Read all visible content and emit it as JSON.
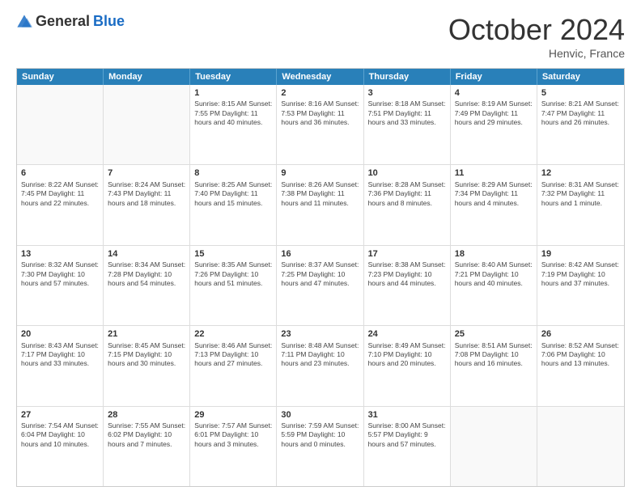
{
  "header": {
    "logo_general": "General",
    "logo_blue": "Blue",
    "month_title": "October 2024",
    "location": "Henvic, France"
  },
  "days_of_week": [
    "Sunday",
    "Monday",
    "Tuesday",
    "Wednesday",
    "Thursday",
    "Friday",
    "Saturday"
  ],
  "rows": [
    [
      {
        "day": "",
        "info": ""
      },
      {
        "day": "",
        "info": ""
      },
      {
        "day": "1",
        "info": "Sunrise: 8:15 AM\nSunset: 7:55 PM\nDaylight: 11 hours and 40 minutes."
      },
      {
        "day": "2",
        "info": "Sunrise: 8:16 AM\nSunset: 7:53 PM\nDaylight: 11 hours and 36 minutes."
      },
      {
        "day": "3",
        "info": "Sunrise: 8:18 AM\nSunset: 7:51 PM\nDaylight: 11 hours and 33 minutes."
      },
      {
        "day": "4",
        "info": "Sunrise: 8:19 AM\nSunset: 7:49 PM\nDaylight: 11 hours and 29 minutes."
      },
      {
        "day": "5",
        "info": "Sunrise: 8:21 AM\nSunset: 7:47 PM\nDaylight: 11 hours and 26 minutes."
      }
    ],
    [
      {
        "day": "6",
        "info": "Sunrise: 8:22 AM\nSunset: 7:45 PM\nDaylight: 11 hours and 22 minutes."
      },
      {
        "day": "7",
        "info": "Sunrise: 8:24 AM\nSunset: 7:43 PM\nDaylight: 11 hours and 18 minutes."
      },
      {
        "day": "8",
        "info": "Sunrise: 8:25 AM\nSunset: 7:40 PM\nDaylight: 11 hours and 15 minutes."
      },
      {
        "day": "9",
        "info": "Sunrise: 8:26 AM\nSunset: 7:38 PM\nDaylight: 11 hours and 11 minutes."
      },
      {
        "day": "10",
        "info": "Sunrise: 8:28 AM\nSunset: 7:36 PM\nDaylight: 11 hours and 8 minutes."
      },
      {
        "day": "11",
        "info": "Sunrise: 8:29 AM\nSunset: 7:34 PM\nDaylight: 11 hours and 4 minutes."
      },
      {
        "day": "12",
        "info": "Sunrise: 8:31 AM\nSunset: 7:32 PM\nDaylight: 11 hours and 1 minute."
      }
    ],
    [
      {
        "day": "13",
        "info": "Sunrise: 8:32 AM\nSunset: 7:30 PM\nDaylight: 10 hours and 57 minutes."
      },
      {
        "day": "14",
        "info": "Sunrise: 8:34 AM\nSunset: 7:28 PM\nDaylight: 10 hours and 54 minutes."
      },
      {
        "day": "15",
        "info": "Sunrise: 8:35 AM\nSunset: 7:26 PM\nDaylight: 10 hours and 51 minutes."
      },
      {
        "day": "16",
        "info": "Sunrise: 8:37 AM\nSunset: 7:25 PM\nDaylight: 10 hours and 47 minutes."
      },
      {
        "day": "17",
        "info": "Sunrise: 8:38 AM\nSunset: 7:23 PM\nDaylight: 10 hours and 44 minutes."
      },
      {
        "day": "18",
        "info": "Sunrise: 8:40 AM\nSunset: 7:21 PM\nDaylight: 10 hours and 40 minutes."
      },
      {
        "day": "19",
        "info": "Sunrise: 8:42 AM\nSunset: 7:19 PM\nDaylight: 10 hours and 37 minutes."
      }
    ],
    [
      {
        "day": "20",
        "info": "Sunrise: 8:43 AM\nSunset: 7:17 PM\nDaylight: 10 hours and 33 minutes."
      },
      {
        "day": "21",
        "info": "Sunrise: 8:45 AM\nSunset: 7:15 PM\nDaylight: 10 hours and 30 minutes."
      },
      {
        "day": "22",
        "info": "Sunrise: 8:46 AM\nSunset: 7:13 PM\nDaylight: 10 hours and 27 minutes."
      },
      {
        "day": "23",
        "info": "Sunrise: 8:48 AM\nSunset: 7:11 PM\nDaylight: 10 hours and 23 minutes."
      },
      {
        "day": "24",
        "info": "Sunrise: 8:49 AM\nSunset: 7:10 PM\nDaylight: 10 hours and 20 minutes."
      },
      {
        "day": "25",
        "info": "Sunrise: 8:51 AM\nSunset: 7:08 PM\nDaylight: 10 hours and 16 minutes."
      },
      {
        "day": "26",
        "info": "Sunrise: 8:52 AM\nSunset: 7:06 PM\nDaylight: 10 hours and 13 minutes."
      }
    ],
    [
      {
        "day": "27",
        "info": "Sunrise: 7:54 AM\nSunset: 6:04 PM\nDaylight: 10 hours and 10 minutes."
      },
      {
        "day": "28",
        "info": "Sunrise: 7:55 AM\nSunset: 6:02 PM\nDaylight: 10 hours and 7 minutes."
      },
      {
        "day": "29",
        "info": "Sunrise: 7:57 AM\nSunset: 6:01 PM\nDaylight: 10 hours and 3 minutes."
      },
      {
        "day": "30",
        "info": "Sunrise: 7:59 AM\nSunset: 5:59 PM\nDaylight: 10 hours and 0 minutes."
      },
      {
        "day": "31",
        "info": "Sunrise: 8:00 AM\nSunset: 5:57 PM\nDaylight: 9 hours and 57 minutes."
      },
      {
        "day": "",
        "info": ""
      },
      {
        "day": "",
        "info": ""
      }
    ]
  ]
}
